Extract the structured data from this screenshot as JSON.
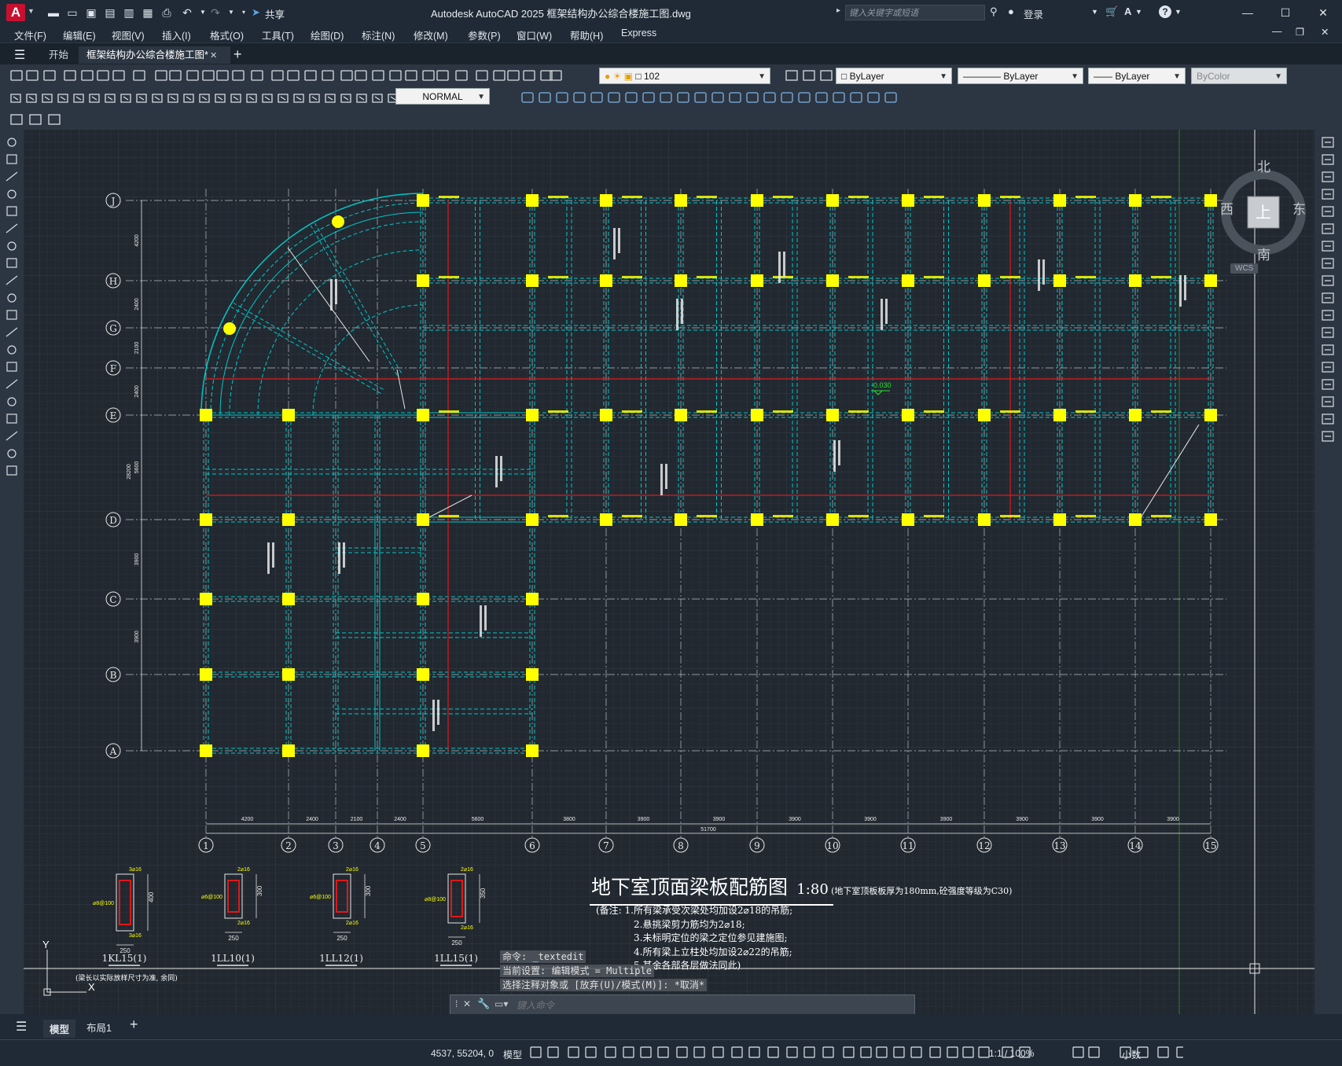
{
  "titlebar": {
    "logo": "A",
    "share_label": "共享",
    "title": "Autodesk AutoCAD 2025    框架结构办公综合楼施工图.dwg",
    "search_placeholder": "键入关键字或短语",
    "login_label": "登录",
    "help_icon": "?"
  },
  "menu": [
    "文件(F)",
    "编辑(E)",
    "视图(V)",
    "插入(I)",
    "格式(O)",
    "工具(T)",
    "绘图(D)",
    "标注(N)",
    "修改(M)",
    "参数(P)",
    "窗口(W)",
    "帮助(H)",
    "Express"
  ],
  "tabs": {
    "start": "开始",
    "active": "框架结构办公综合楼施工图*",
    "add": "+"
  },
  "toolbar": {
    "layer_value": "102",
    "color_value": "ByLayer",
    "linetype_value": "ByLayer",
    "lineweight_value": "ByLayer",
    "plotstyle_value": "ByColor",
    "textstyle_value": "NORMAL"
  },
  "viewcube": {
    "north": "北",
    "south": "南",
    "east": "东",
    "west": "西",
    "face": "上",
    "wcs": "WCS"
  },
  "drawing": {
    "title": "地下室顶面梁板配筋图",
    "scale": "1:80",
    "title_note": "(地下室顶板板厚为180mm,砼强度等级为C30)",
    "notes": [
      "(备注: 1.所有梁承受次梁处均加设2⌀18的吊筋;",
      "2.悬挑梁剪力筋均为2⌀18;",
      "3.未标明定位的梁之定位参见建施图;",
      "4.所有梁上立柱处均加设2⌀22的吊筋;",
      "5.其余各部各层做法同此)"
    ],
    "row_axes": [
      "J",
      "H",
      "G",
      "F",
      "E",
      "D",
      "C",
      "B",
      "A"
    ],
    "col_axes": [
      "1",
      "2",
      "3",
      "4",
      "5",
      "6",
      "7",
      "8",
      "9",
      "10",
      "11",
      "12",
      "13",
      "14",
      "15"
    ],
    "col_dims": [
      "4200",
      "2400",
      "2100",
      "2400",
      "5600",
      "3800",
      "3900",
      "3900",
      "3900",
      "3900",
      "3900",
      "3900",
      "3900",
      "3900"
    ],
    "total_dim": "51700",
    "row_dims": [
      "4200",
      "2400",
      "2100",
      "2400",
      "5600",
      "3900",
      "3900"
    ],
    "overall_row_dim": "28200",
    "level_mark": "-0.030",
    "sections": [
      {
        "label": "1KL15(1)",
        "width": "250",
        "height": "400",
        "top": "3⌀16",
        "bottom": "3⌀16",
        "stirrup": "⌀8@100"
      },
      {
        "label": "1LL10(1)",
        "width": "250",
        "height": "300",
        "top": "2⌀16",
        "bottom": "2⌀16",
        "stirrup": "⌀6@100"
      },
      {
        "label": "1LL12(1)",
        "width": "250",
        "height": "300",
        "top": "2⌀16",
        "bottom": "2⌀16",
        "stirrup": "⌀6@100"
      },
      {
        "label": "1LL15(1)",
        "width": "250",
        "height": "350",
        "top": "2⌀16",
        "bottom": "2⌀16",
        "stirrup": "⌀8@100"
      }
    ],
    "section_note": "(梁长以实际放样尺寸为准, 余同)",
    "ucs_y": "Y",
    "ucs_x": "X"
  },
  "command": {
    "history": [
      "命令: _textedit",
      "当前设置: 编辑模式 = Multiple",
      "选择注释对象或 [放弃(U)/模式(M)]: *取消*"
    ],
    "placeholder": "键入命令"
  },
  "model_tabs": {
    "model": "模型",
    "layout1": "布局1",
    "add": "+"
  },
  "status": {
    "coords": "4537, 55204, 0",
    "space": "模型",
    "scale": "1:1 / 100%",
    "units": "小数"
  },
  "colors": {
    "column": "#ffff00",
    "beam": "#00c8c8",
    "axis": "#ffffff",
    "red": "#e01818",
    "text_yellow": "#ffff00",
    "bg": "#212830"
  }
}
